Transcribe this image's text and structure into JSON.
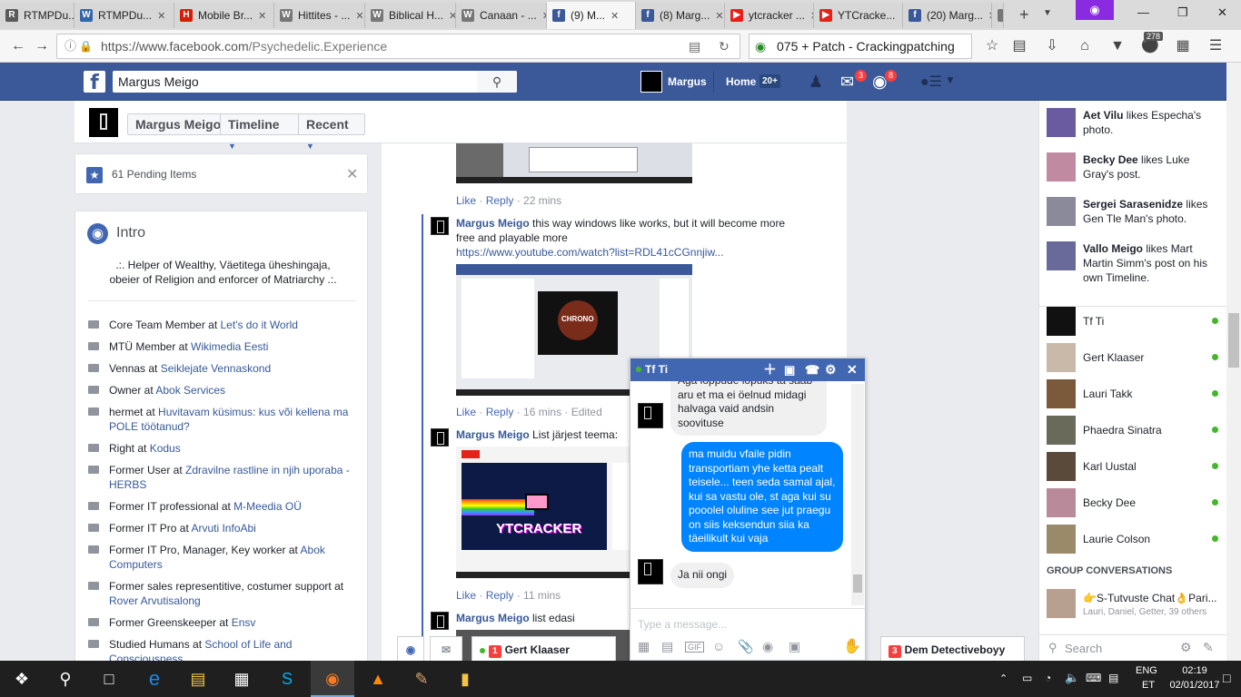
{
  "browser": {
    "tabs": [
      {
        "label": "RTMPDu...",
        "fav": "R",
        "color": "#5a5a5a"
      },
      {
        "label": "RTMPDu...",
        "fav": "W",
        "color": "#3366aa"
      },
      {
        "label": "Mobile Br...",
        "fav": "H",
        "color": "#d81e06"
      },
      {
        "label": "Hittites - ...",
        "fav": "W",
        "color": "#777777"
      },
      {
        "label": "Biblical H...",
        "fav": "W",
        "color": "#777777"
      },
      {
        "label": "Canaan - ...",
        "fav": "W",
        "color": "#777777"
      },
      {
        "label": "(9) M...",
        "fav": "f",
        "color": "#3b5998"
      },
      {
        "label": "(8) Marg...",
        "fav": "f",
        "color": "#3b5998"
      },
      {
        "label": "ytcracker ...",
        "fav": "▶",
        "color": "#e62117"
      },
      {
        "label": "YTCracke...",
        "fav": "▶",
        "color": "#e62117"
      },
      {
        "label": "(20) Marg...",
        "fav": "f",
        "color": "#3b5998"
      },
      {
        "label": "V",
        "fav": "",
        "color": "#777777"
      }
    ],
    "url": "https://www.facebook.com/Psychedelic.Experience",
    "url_domain": "https://www.facebook.com",
    "url_path": "/Psychedelic.Experience",
    "search_text": "075 + Patch - Crackingpatching",
    "addon_badge": "278"
  },
  "fb": {
    "search_value": "Margus Meigo",
    "profile_name": "Margus",
    "home_label": "Home",
    "home_count": "20+",
    "msg_badge": "3",
    "notif_badge": "8"
  },
  "profile": {
    "name_btn": "Margus Meigo",
    "timeline_btn": "Timeline",
    "recent_btn": "Recent"
  },
  "pending": {
    "label": "61 Pending Items"
  },
  "intro": {
    "title": "Intro",
    "bio": ".:. Helper of Wealthy, Väetitega üheshingaja, obeier of Religion and enforcer of Matriarchy .:.",
    "items": [
      {
        "pre": "Core Team Member at ",
        "link": "Let's do it World"
      },
      {
        "pre": "MTÜ Member at ",
        "link": "Wikimedia Eesti"
      },
      {
        "pre": "Vennas at ",
        "link": "Seiklejate Vennaskond"
      },
      {
        "pre": "Owner at ",
        "link": "Abok Services"
      },
      {
        "pre": "hermet at ",
        "link": "Huvitavam küsimus: kus või kellena ma POLE töötanud?"
      },
      {
        "pre": "Right at ",
        "link": "Kodus"
      },
      {
        "pre": "Former User at ",
        "link": "Zdravilne rastline in njih uporaba - HERBS"
      },
      {
        "pre": "Former IT professional at ",
        "link": "M-Meedia OÜ"
      },
      {
        "pre": "Former IT Pro at ",
        "link": "Arvuti InfoAbi"
      },
      {
        "pre": "Former IT Pro, Manager, Key worker at ",
        "link": "Abok Computers"
      },
      {
        "pre": "Former sales representitive, costumer support at ",
        "link": "Rover Arvutisalong"
      },
      {
        "pre": "Former Greenskeeper at ",
        "link": "Ensv"
      },
      {
        "pre": "Studied Humans at ",
        "link": "School of Life and Consciousness"
      }
    ]
  },
  "feed": {
    "like": "Like",
    "reply": "Reply",
    "c1_time": "22 mins",
    "c2_name": "Margus Meigo",
    "c2_text": "this way windows like works, but it will become more free and playable more",
    "c2_link": "https://www.youtube.com/watch?list=RDL41cCGnnjiw...",
    "c2_time": "16 mins",
    "c2_edited": "Edited",
    "c3_name": "Margus Meigo",
    "c3_text": "List järjest teema:",
    "c3_thumb_title": "YTCRACKER",
    "c3_time": "11 mins",
    "c4_name": "Margus Meigo",
    "c4_text": "list edasi",
    "chrono": "CHRONO"
  },
  "ticker": [
    {
      "name": "Aet Vilu",
      "rest": " likes Especha's photo."
    },
    {
      "name": "Becky Dee",
      "rest": " likes Luke Gray's post."
    },
    {
      "name": "Sergei Sarasenidze",
      "rest": " likes Gen Tle Man's photo."
    },
    {
      "name": "Vallo Meigo",
      "rest": " likes Mart Martin Simm's post on his own Timeline."
    }
  ],
  "contacts": [
    {
      "name": "Tf Ti",
      "color": "#111111"
    },
    {
      "name": "Gert Klaaser",
      "color": "#c9b9a8"
    },
    {
      "name": "Lauri Takk",
      "color": "#7a5a3a"
    },
    {
      "name": "Phaedra Sinatra",
      "color": "#6a6a5a"
    },
    {
      "name": "Karl Uustal",
      "color": "#5a4a3a"
    },
    {
      "name": "Becky Dee",
      "color": "#b98a9a"
    },
    {
      "name": "Laurie Colson",
      "color": "#9a8a6a"
    }
  ],
  "groups": {
    "title": "GROUP CONVERSATIONS",
    "name": "👉S-Tutvuste Chat👌Pari...",
    "members": "Lauri, Daniel, Getter, 39 others"
  },
  "sidebar_search": "Search",
  "chat": {
    "name": "Tf Ti",
    "msg_in_1": "Aga loppude lõpuks ta saab aru et ma ei öelnud midagi halvaga vaid andsin soovituse",
    "msg_out_1": "ma muidu vfaile pidin transportiam yhe ketta pealt teisele... teen seda samal ajal, kui sa vastu ole, st aga kui su pooolel oluline see jut praegu on siis keksendun siia ka täeilikult kui vaja",
    "msg_in_2": "Ja nii ongi",
    "placeholder": "Type a message..."
  },
  "dock": {
    "gert_badge": "1",
    "gert_name": "Gert Klaaser",
    "dem_badge": "3",
    "dem_name": "Dem Detectiveboyy"
  },
  "taskbar": {
    "lang": "ENG",
    "region": "ET",
    "time": "02:19",
    "date": "02/01/2017"
  }
}
